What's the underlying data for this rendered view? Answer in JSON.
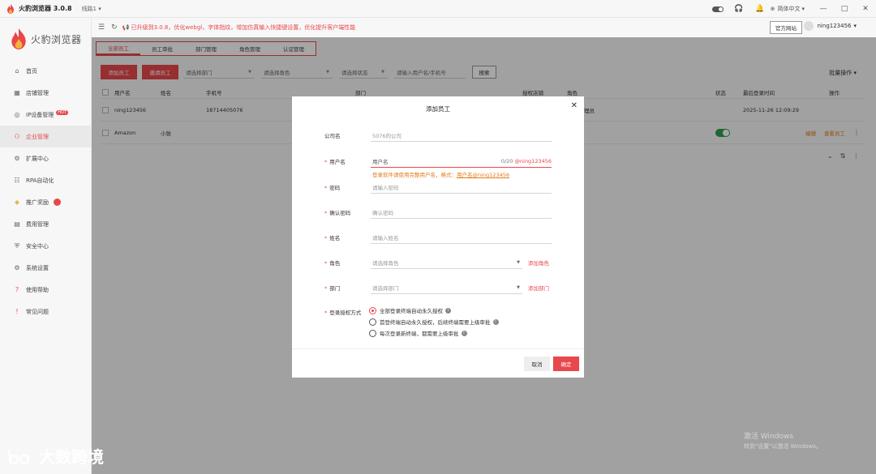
{
  "titlebar": {
    "app_title": "火豹浏览器 3.0.8",
    "line": "线路1",
    "lang": "简体中文"
  },
  "header": {
    "notice": "已升级到3.0.8，优化webgl，字体指纹，增加仿真输入快捷键设置，优化提升客户端性能",
    "official": "官方网站",
    "username": "ning123456"
  },
  "sidebar": {
    "logo_text": "火豹浏览器",
    "hot_badge": "HOT",
    "items": [
      {
        "label": "首页",
        "icon": "home-icon"
      },
      {
        "label": "店铺管理",
        "icon": "shop-icon"
      },
      {
        "label": "IP设备管理",
        "icon": "ip-icon"
      },
      {
        "label": "企业管理",
        "icon": "enterprise-icon"
      },
      {
        "label": "扩展中心",
        "icon": "extension-icon"
      },
      {
        "label": "RPA自动化",
        "icon": "rpa-icon"
      },
      {
        "label": "推广奖励",
        "icon": "reward-icon"
      },
      {
        "label": "费用管理",
        "icon": "fee-icon"
      },
      {
        "label": "安全中心",
        "icon": "security-icon"
      },
      {
        "label": "系统设置",
        "icon": "settings-icon"
      },
      {
        "label": "使用帮助",
        "icon": "help-icon"
      },
      {
        "label": "常见问题",
        "icon": "faq-icon"
      }
    ]
  },
  "tabs": [
    "全部员工",
    "员工审批",
    "部门管理",
    "角色管理",
    "认证管理"
  ],
  "toolbar": {
    "add_employee": "添加员工",
    "invite_employee": "邀请员工",
    "filter_dept": "请选择部门",
    "filter_role": "请选择角色",
    "filter_status": "请选择状态",
    "search_placeholder": "请输入用户名/手机号",
    "search_btn": "搜索",
    "bulk": "批量操作"
  },
  "table": {
    "headers": {
      "user": "用户名",
      "name": "姓名",
      "phone": "手机号",
      "dept": "部门",
      "shops": "授权店铺",
      "role": "角色",
      "status": "状态",
      "last_login": "最后登录时间",
      "ops": "操作"
    },
    "rows": [
      {
        "user": "ning123456",
        "name": "",
        "phone": "18714405076",
        "role": "理员",
        "last_login": "2025-11-26 12:09:29"
      },
      {
        "user": "Amazon",
        "name": "小张",
        "phone": "",
        "role": "",
        "last_login": "",
        "edit": "编辑",
        "view_staff": "查看员工"
      }
    ]
  },
  "modal": {
    "title": "添加员工",
    "company_label": "公司名",
    "company_value": "5076的公司",
    "username_label": "用户名",
    "username_placeholder": "用户名",
    "username_count": "0/20",
    "username_suffix": "@ning123456",
    "username_error": "登录软件请使用完整用户名，格式：",
    "username_error_example": "用户名@ning123456",
    "password_label": "密码",
    "password_placeholder": "请输入密码",
    "confirm_label": "确认密码",
    "confirm_placeholder": "确认密码",
    "name_label": "姓名",
    "name_placeholder": "请输入姓名",
    "role_label": "角色",
    "role_placeholder": "请选择角色",
    "role_add": "添加角色",
    "dept_label": "部门",
    "dept_placeholder": "请选择部门",
    "dept_add": "添加部门",
    "auth_label": "登录授权方式",
    "auth_options": [
      "全部登录终端自动永久授权",
      "首登终端自动永久授权，后续终端需要上级审批",
      "每次登录新终端，都需要上级审批"
    ],
    "cancel": "取消",
    "ok": "确定"
  },
  "watermark": "大数跨境",
  "windows": {
    "line1": "激活 Windows",
    "line2": "转到\"设置\"以激活 Windows。"
  }
}
